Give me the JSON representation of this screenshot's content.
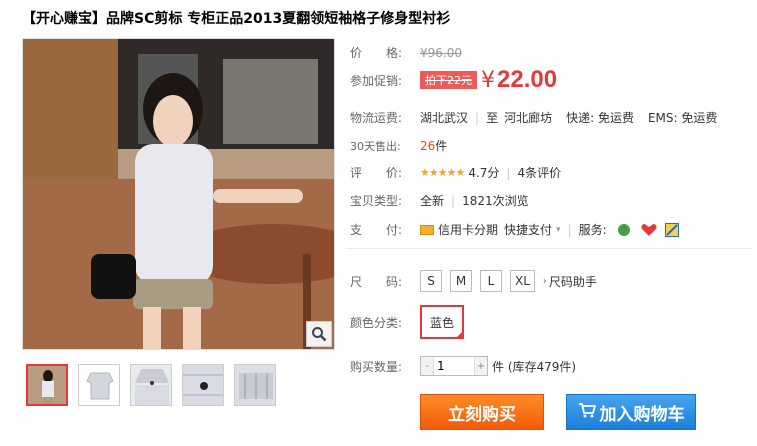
{
  "product": {
    "title": "【开心赚宝】品牌SC剪标 专柜正品2013夏翻领短袖格子修身型衬衫"
  },
  "gallery": {
    "thumb_count": 5,
    "zoom_icon": "magnifier-icon"
  },
  "price": {
    "label": "价　　格:",
    "original": "¥96.00"
  },
  "promo": {
    "label": "参加促销:",
    "tag": "拍下22元",
    "symbol": "¥",
    "price": "22.00"
  },
  "shipping": {
    "label": "物流运费:",
    "from": "湖北武汉",
    "to_prefix": "至",
    "to": "河北廊坊",
    "express": "快递: 免运费",
    "ems": "EMS: 免运费"
  },
  "sales": {
    "label": "30天售出:",
    "count": "26",
    "unit": "件"
  },
  "rating": {
    "label": "评　　价:",
    "stars": "★★★★★",
    "score": "4.7分",
    "reviews": "4条评价"
  },
  "item_type": {
    "label": "宝贝类型:",
    "condition": "全新",
    "views": "1821次浏览"
  },
  "payment": {
    "label": "支　　付:",
    "credit": "信用卡分期",
    "quick": "快捷支付",
    "service_label": "服务:"
  },
  "size": {
    "label": "尺　　码:",
    "options": [
      "S",
      "M",
      "L",
      "XL"
    ],
    "help": "尺码助手"
  },
  "color": {
    "label": "颜色分类:",
    "selected": "蓝色"
  },
  "quantity": {
    "label": "购买数量:",
    "minus": "-",
    "value": "1",
    "plus": "+",
    "stock": "件 (库存479件)"
  },
  "actions": {
    "buy": "立刻购买",
    "cart": "加入购物车"
  },
  "colors": {
    "accent": "#e4393c",
    "buy": "#f15a0a",
    "cart": "#1c80d8"
  }
}
